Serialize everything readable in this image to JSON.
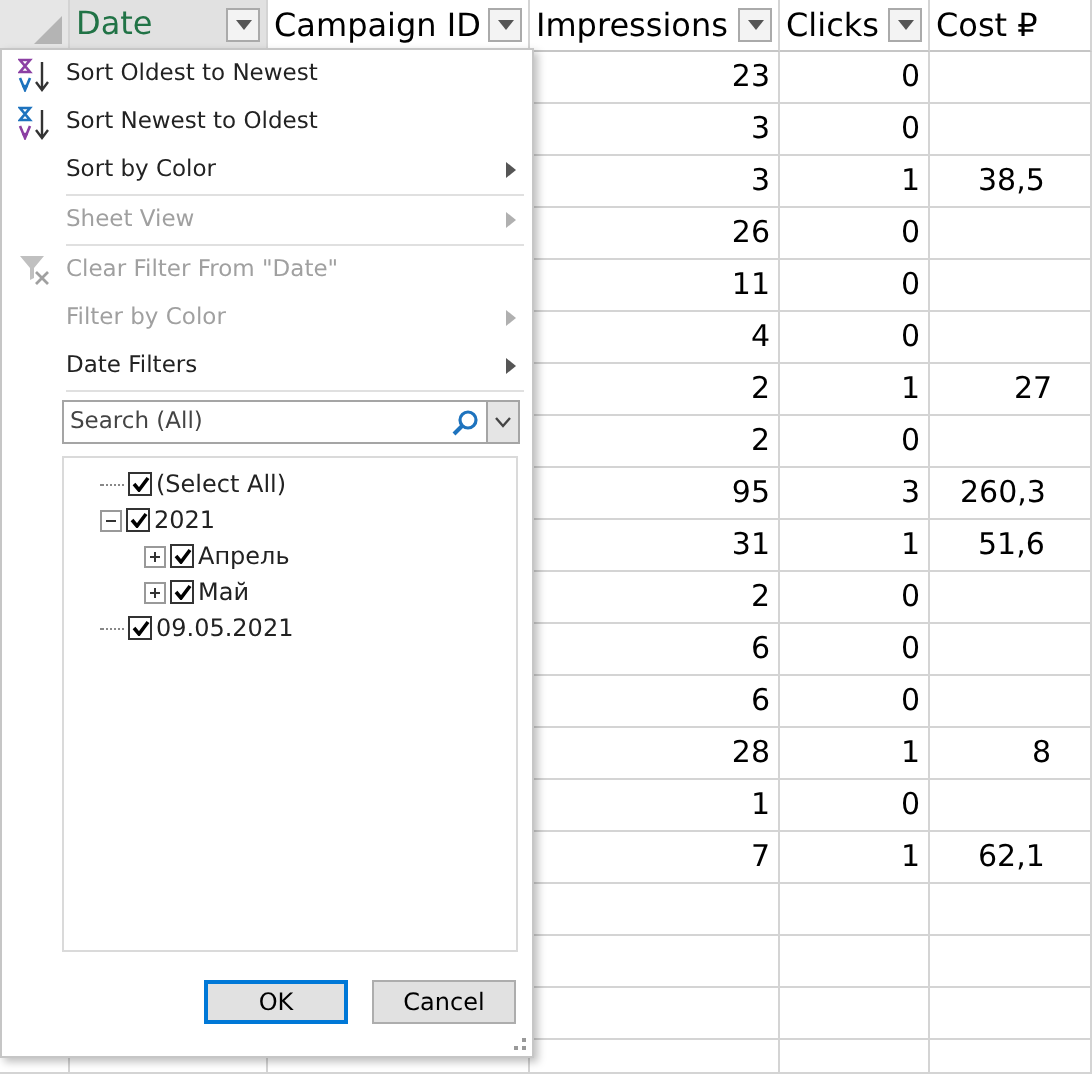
{
  "sheet": {
    "columns": [
      {
        "label": "Date",
        "filter": true,
        "selected": true
      },
      {
        "label": "Campaign ID",
        "filter": true,
        "selected": false
      },
      {
        "label": "Impressions",
        "filter": true,
        "selected": false
      },
      {
        "label": "Clicks",
        "filter": true,
        "selected": false
      },
      {
        "label": "Cost ₽",
        "filter": false,
        "selected": false
      }
    ],
    "rows": [
      {
        "impressions": "23",
        "clicks": "0"
      },
      {
        "impressions": "3",
        "clicks": "0"
      },
      {
        "impressions": "3",
        "clicks": "1",
        "cost": "38,5"
      },
      {
        "impressions": "26",
        "clicks": "0"
      },
      {
        "impressions": "11",
        "clicks": "0"
      },
      {
        "impressions": "4",
        "clicks": "0"
      },
      {
        "impressions": "2",
        "clicks": "1",
        "cost": "27"
      },
      {
        "impressions": "2",
        "clicks": "0"
      },
      {
        "impressions": "95",
        "clicks": "3",
        "cost": "260,3"
      },
      {
        "impressions": "31",
        "clicks": "1",
        "cost": "51,6"
      },
      {
        "impressions": "2",
        "clicks": "0"
      },
      {
        "impressions": "6",
        "clicks": "0"
      },
      {
        "impressions": "6",
        "clicks": "0"
      },
      {
        "impressions": "28",
        "clicks": "1",
        "cost": "8"
      },
      {
        "impressions": "1",
        "clicks": "0"
      },
      {
        "impressions": "7",
        "clicks": "1",
        "cost": "62,1"
      }
    ]
  },
  "filter_menu": {
    "items": [
      {
        "kind": "ascending",
        "label": "Sort Oldest to Newest",
        "disabled": false,
        "submenu": false
      },
      {
        "kind": "descending",
        "label": "Sort Newest to Oldest",
        "disabled": false,
        "submenu": false
      },
      {
        "kind": "item",
        "label": "Sort by Color",
        "disabled": false,
        "submenu": true
      },
      {
        "kind": "separator"
      },
      {
        "kind": "item",
        "label": "Sheet View",
        "disabled": true,
        "submenu": true
      },
      {
        "kind": "separator"
      },
      {
        "kind": "clear",
        "label": "Clear Filter From \"Date\"",
        "disabled": true,
        "submenu": false
      },
      {
        "kind": "item",
        "label": "Filter by Color",
        "disabled": true,
        "submenu": true
      },
      {
        "kind": "item",
        "label": "Date Filters",
        "disabled": false,
        "submenu": true
      },
      {
        "kind": "separator"
      }
    ],
    "search": {
      "placeholder": "Search (All)"
    },
    "tree": [
      {
        "label": "(Select All)",
        "checked": true
      },
      {
        "label": "2021",
        "checked": true,
        "expanded": true,
        "children": [
          {
            "label": "Апрель",
            "checked": true,
            "expanded": false
          },
          {
            "label": "Май",
            "checked": true,
            "expanded": false
          }
        ]
      },
      {
        "label": "09.05.2021",
        "checked": true
      }
    ],
    "buttons": [
      {
        "label": "OK",
        "default": true
      },
      {
        "label": "Cancel",
        "default": false
      }
    ]
  }
}
